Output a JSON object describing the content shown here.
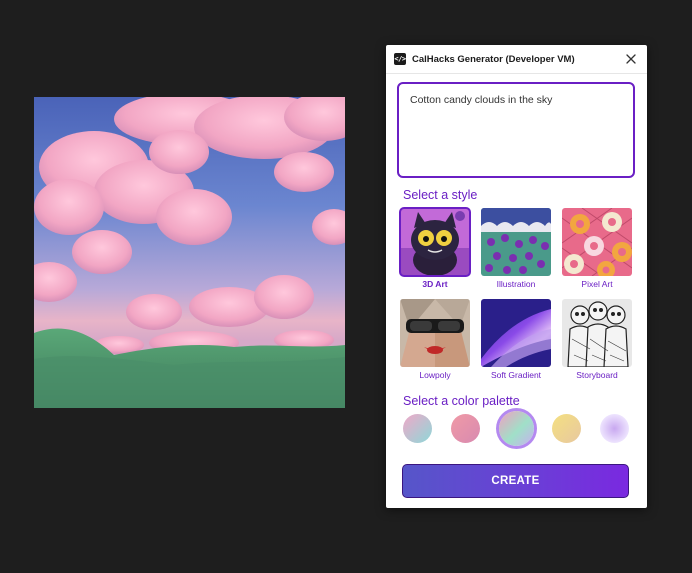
{
  "window": {
    "title": "CalHacks Generator (Developer VM)",
    "app_icon_glyph": "</>"
  },
  "prompt": {
    "value": "Cotton candy clouds in the sky"
  },
  "style_section": {
    "label": "Select a style",
    "items": [
      {
        "label": "3D Art",
        "selected": true
      },
      {
        "label": "Illustration",
        "selected": false
      },
      {
        "label": "Pixel Art",
        "selected": false
      },
      {
        "label": "Lowpoly",
        "selected": false
      },
      {
        "label": "Soft Gradient",
        "selected": false
      },
      {
        "label": "Storyboard",
        "selected": false
      }
    ]
  },
  "palette_section": {
    "label": "Select a color palette",
    "swatches": [
      {
        "colors": [
          "#f0a8c8",
          "#8ed8d8"
        ],
        "selected": false
      },
      {
        "colors": [
          "#f09aa6",
          "#d88ab0"
        ],
        "selected": false
      },
      {
        "colors": [
          "#f0a0c0",
          "#a0e0c8",
          "#c8b0f0"
        ],
        "selected": true
      },
      {
        "colors": [
          "#f4e080",
          "#e8c8a0"
        ],
        "selected": false
      },
      {
        "colors": [
          "#ffffff",
          "#d0b8f0"
        ],
        "selected": false
      }
    ]
  },
  "create_button": {
    "label": "CREATE"
  },
  "colors": {
    "accent": "#6a1fc4",
    "background": "#1e1e1e"
  }
}
